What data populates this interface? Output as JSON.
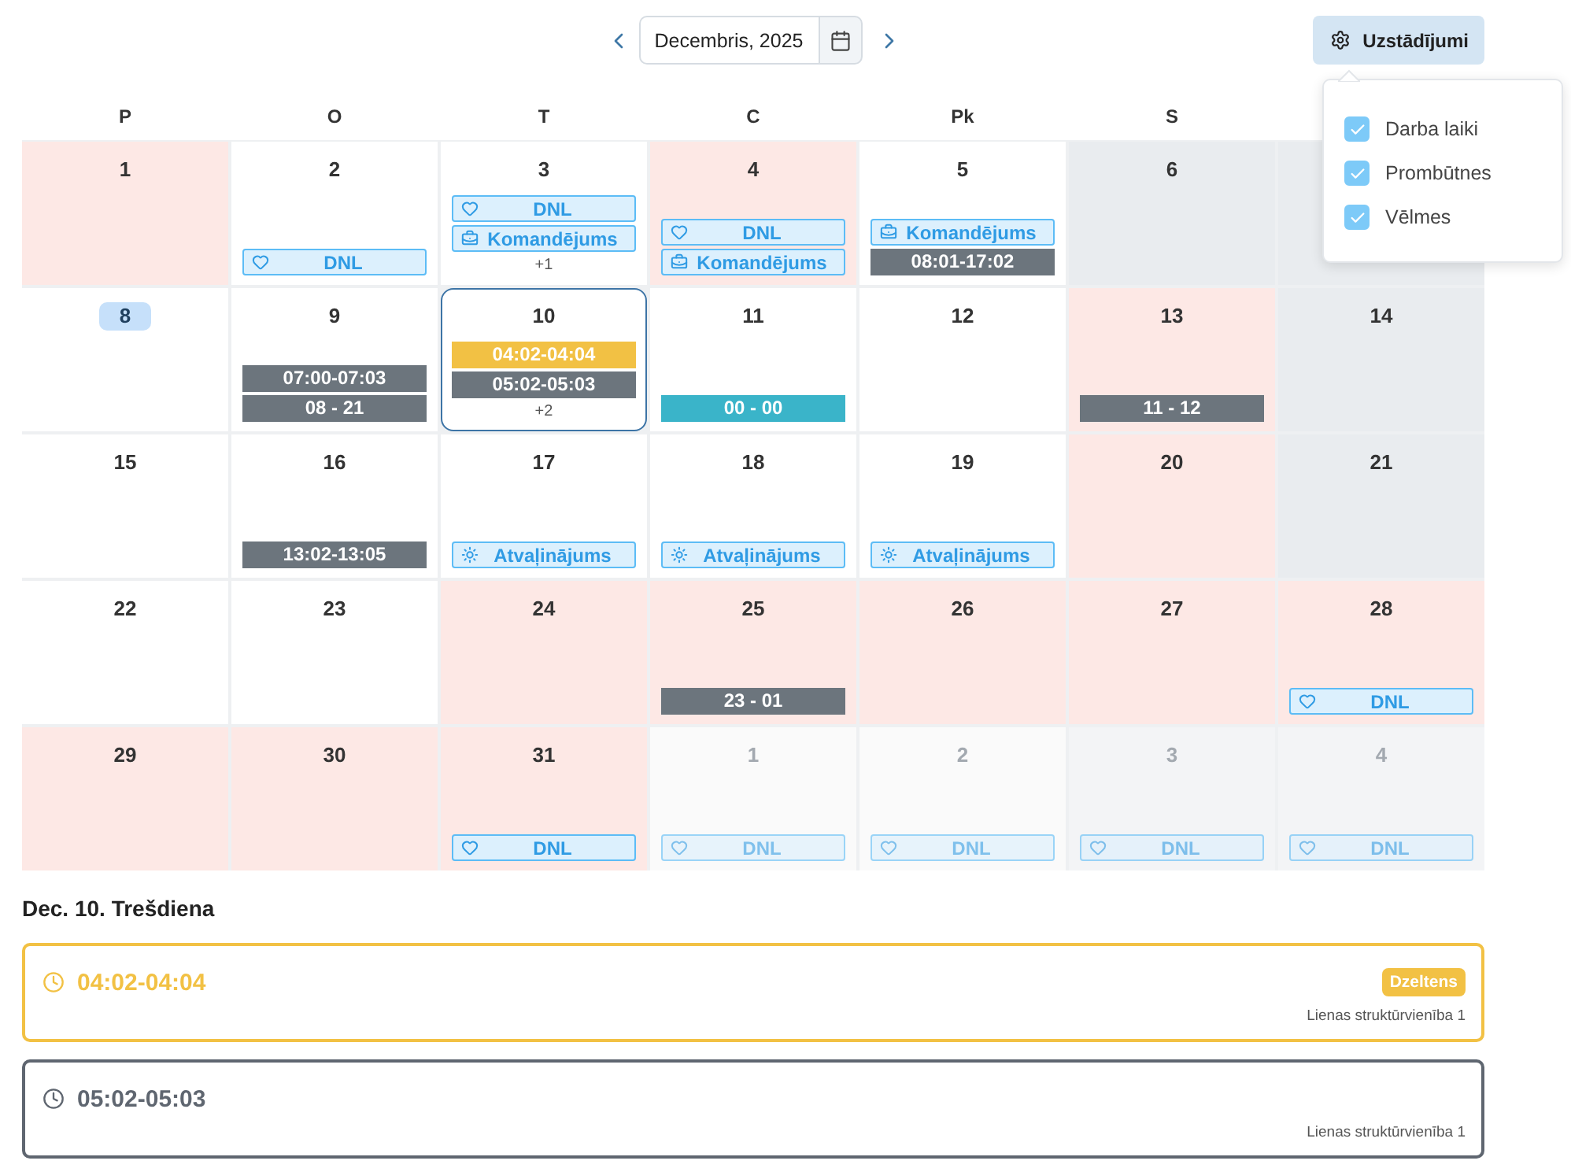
{
  "toolbar": {
    "month": "Decembris, 2025",
    "settings_label": "Uzstādījumi"
  },
  "settings_menu": {
    "options": [
      {
        "label": "Darba laiki",
        "checked": true
      },
      {
        "label": "Prombūtnes",
        "checked": true
      },
      {
        "label": "Vēlmes",
        "checked": true
      }
    ]
  },
  "weekdays": [
    "P",
    "O",
    "T",
    "C",
    "Pk",
    "S"
  ],
  "weeks": [
    [
      {
        "day": "1",
        "kind": "marked",
        "outside": false,
        "today": false,
        "selected": false
      },
      {
        "day": "2",
        "kind": "day",
        "outside": false,
        "today": false,
        "selected": false,
        "events": [
          {
            "kind": "heart",
            "label": "DNL"
          }
        ]
      },
      {
        "day": "3",
        "kind": "day",
        "outside": false,
        "today": false,
        "selected": false,
        "events": [
          {
            "kind": "heart",
            "label": "DNL"
          },
          {
            "kind": "briefcase",
            "label": "Komandējums"
          }
        ],
        "more": "+1"
      },
      {
        "day": "4",
        "kind": "marked",
        "outside": false,
        "today": false,
        "selected": false,
        "events": [
          {
            "kind": "heart",
            "label": "DNL"
          },
          {
            "kind": "briefcase",
            "label": "Komandējums"
          }
        ]
      },
      {
        "day": "5",
        "kind": "day",
        "outside": false,
        "today": false,
        "selected": false,
        "events": [
          {
            "kind": "briefcase",
            "label": "Komandējums"
          },
          {
            "kind": "time",
            "label": "08:01-17:02",
            "color": "#6c757d"
          }
        ]
      },
      {
        "day": "6",
        "kind": "weekend",
        "outside": false,
        "today": false,
        "selected": false
      },
      {
        "kind": "weekend",
        "selected": false
      }
    ],
    [
      {
        "day": "8",
        "kind": "day",
        "outside": false,
        "today": true,
        "selected": false
      },
      {
        "day": "9",
        "kind": "day",
        "outside": false,
        "today": false,
        "selected": false,
        "events": [
          {
            "kind": "time",
            "label": "07:00-07:03",
            "color": "#6c757d"
          },
          {
            "kind": "time",
            "label": "08 - 21",
            "color": "#6c757d"
          }
        ]
      },
      {
        "day": "10",
        "kind": "day",
        "outside": false,
        "today": false,
        "selected": true,
        "events": [
          {
            "kind": "time",
            "label": "04:02-04:04",
            "color": "#f2c144"
          },
          {
            "kind": "time",
            "label": "05:02-05:03",
            "color": "#6c757d"
          }
        ],
        "more": "+2"
      },
      {
        "day": "11",
        "kind": "day",
        "outside": false,
        "today": false,
        "selected": false,
        "events": [
          {
            "kind": "time",
            "label": "00 - 00",
            "color": "#3ab4c9"
          }
        ]
      },
      {
        "day": "12",
        "kind": "day",
        "outside": false,
        "today": false,
        "selected": false
      },
      {
        "day": "13",
        "kind": "marked",
        "outside": false,
        "today": false,
        "selected": false,
        "events": [
          {
            "kind": "time",
            "label": "11 - 12",
            "color": "#6c757d"
          }
        ]
      },
      {
        "day": "14",
        "kind": "weekend",
        "outside": false,
        "today": false,
        "selected": false
      }
    ],
    [
      {
        "day": "15",
        "kind": "day",
        "outside": false,
        "today": false,
        "selected": false
      },
      {
        "day": "16",
        "kind": "day",
        "outside": false,
        "today": false,
        "selected": false,
        "events": [
          {
            "kind": "time",
            "label": "13:02-13:05",
            "color": "#6c757d"
          }
        ]
      },
      {
        "day": "17",
        "kind": "day",
        "outside": false,
        "today": false,
        "selected": false,
        "events": [
          {
            "kind": "sun",
            "label": "Atvaļinājums"
          }
        ]
      },
      {
        "day": "18",
        "kind": "day",
        "outside": false,
        "today": false,
        "selected": false,
        "events": [
          {
            "kind": "sun",
            "label": "Atvaļinājums"
          }
        ]
      },
      {
        "day": "19",
        "kind": "day",
        "outside": false,
        "today": false,
        "selected": false,
        "events": [
          {
            "kind": "sun",
            "label": "Atvaļinājums"
          }
        ]
      },
      {
        "day": "20",
        "kind": "marked",
        "outside": false,
        "today": false,
        "selected": false
      },
      {
        "day": "21",
        "kind": "weekend",
        "outside": false,
        "today": false,
        "selected": false
      }
    ],
    [
      {
        "day": "22",
        "kind": "day",
        "outside": false,
        "today": false,
        "selected": false
      },
      {
        "day": "23",
        "kind": "day",
        "outside": false,
        "today": false,
        "selected": false
      },
      {
        "day": "24",
        "kind": "marked",
        "outside": false,
        "today": false,
        "selected": false
      },
      {
        "day": "25",
        "kind": "marked",
        "outside": false,
        "today": false,
        "selected": false,
        "events": [
          {
            "kind": "time",
            "label": "23 - 01",
            "color": "#6c757d"
          }
        ]
      },
      {
        "day": "26",
        "kind": "marked",
        "outside": false,
        "today": false,
        "selected": false
      },
      {
        "day": "27",
        "kind": "marked",
        "outside": false,
        "today": false,
        "selected": false
      },
      {
        "day": "28",
        "kind": "marked",
        "outside": false,
        "today": false,
        "selected": false,
        "events": [
          {
            "kind": "heart",
            "label": "DNL"
          }
        ]
      }
    ],
    [
      {
        "day": "29",
        "kind": "marked",
        "outside": false,
        "today": false,
        "selected": false
      },
      {
        "day": "30",
        "kind": "marked",
        "outside": false,
        "today": false,
        "selected": false
      },
      {
        "day": "31",
        "kind": "marked",
        "outside": false,
        "today": false,
        "selected": false,
        "events": [
          {
            "kind": "heart",
            "label": "DNL"
          }
        ]
      },
      {
        "day": "1",
        "kind": "day",
        "outside": true,
        "today": false,
        "selected": false,
        "events": [
          {
            "kind": "heart",
            "label": "DNL"
          }
        ]
      },
      {
        "day": "2",
        "kind": "day",
        "outside": true,
        "today": false,
        "selected": false,
        "events": [
          {
            "kind": "heart",
            "label": "DNL"
          }
        ]
      },
      {
        "day": "3",
        "kind": "weekend",
        "outside": true,
        "today": false,
        "selected": false,
        "events": [
          {
            "kind": "heart",
            "label": "DNL"
          }
        ]
      },
      {
        "day": "4",
        "kind": "weekend",
        "outside": true,
        "today": false,
        "selected": false,
        "events": [
          {
            "kind": "heart",
            "label": "DNL"
          }
        ]
      }
    ]
  ],
  "details": {
    "title": "Dec. 10. Trešdiena",
    "entries": [
      {
        "time": "04:02-04:04",
        "color": "#f2c144",
        "badge": "Dzeltens",
        "unit": "Lienas struktūrvienība 1"
      },
      {
        "time": "05:02-05:03",
        "color": "#5f6670",
        "unit": "Lienas struktūrvienība 1"
      }
    ]
  }
}
